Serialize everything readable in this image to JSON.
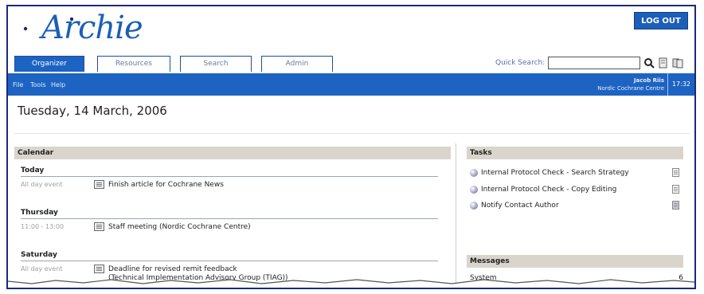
{
  "app": {
    "logo_text": "Archie",
    "logout_label": "LOG OUT"
  },
  "tabs": [
    {
      "label": "Organizer",
      "active": true
    },
    {
      "label": "Resources",
      "active": false
    },
    {
      "label": "Search",
      "active": false
    },
    {
      "label": "Admin",
      "active": false
    }
  ],
  "quick_search": {
    "label": "Quick Search:",
    "value": ""
  },
  "menu": [
    "File",
    "Tools",
    "Help"
  ],
  "user": {
    "name": "Jacob Riis",
    "centre": "Nordic Cochrane Centre"
  },
  "clock": "17:32",
  "date_title": "Tuesday, 14 March, 2006",
  "calendar": {
    "header": "Calendar",
    "days": [
      {
        "title": "Today",
        "events": [
          {
            "time": "All day event",
            "text": "Finish article for Cochrane News",
            "text2": ""
          }
        ]
      },
      {
        "title": "Thursday",
        "events": [
          {
            "time": "11:00 - 13:00",
            "text": "Staff meeting (Nordic Cochrane Centre)",
            "text2": ""
          }
        ]
      },
      {
        "title": "Saturday",
        "events": [
          {
            "time": "All day event",
            "text": "Deadline for revised remit feedback",
            "text2": "(Technical Implementation Advisory Group (TIAG))"
          }
        ]
      }
    ]
  },
  "tasks": {
    "header": "Tasks",
    "items": [
      "Internal Protocol Check - Search Strategy",
      "Internal Protocol Check - Copy Editing",
      "Notify Contact Author"
    ]
  },
  "messages": {
    "header": "Messages",
    "items": [
      {
        "label": "System",
        "count": "6"
      }
    ]
  },
  "colors": {
    "accent": "#1d63c2",
    "frame": "#1b2a78",
    "panel_header": "#d9d5cd"
  }
}
